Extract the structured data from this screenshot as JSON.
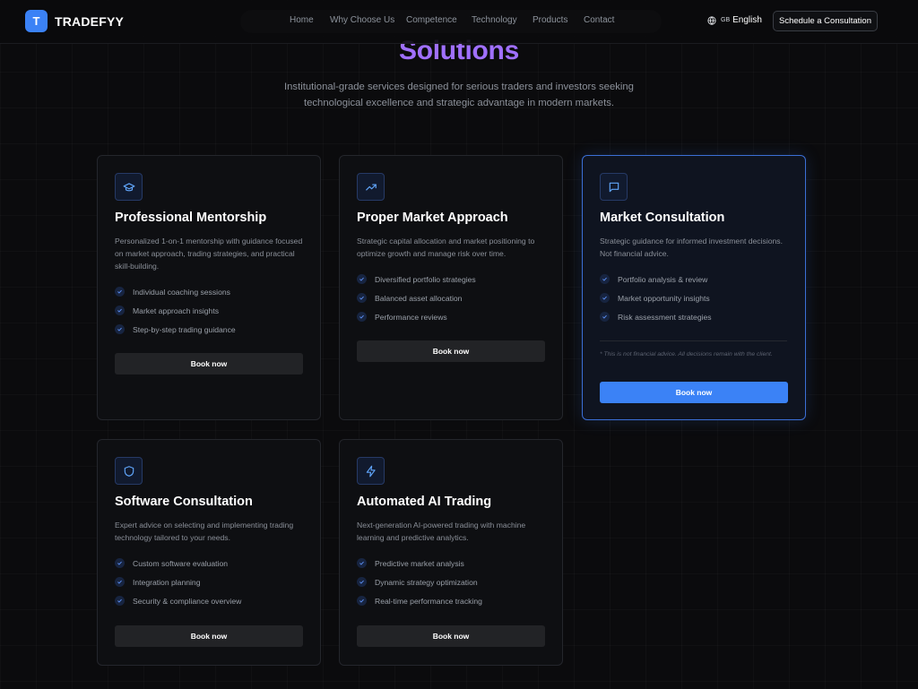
{
  "brand": {
    "logo_letter": "T",
    "name": "TRADEFYY",
    "accent": "#3b82f6"
  },
  "nav": {
    "links": [
      "Home",
      "Why Choose Us",
      "Competence",
      "Technology",
      "Products",
      "Contact"
    ],
    "language_flag": "GB",
    "language": "English",
    "cta": "Schedule a Consultation"
  },
  "hero": {
    "title": "Solutions",
    "subtitle": "Institutional-grade services designed for serious traders and investors seeking technological excellence and strategic advantage in modern markets.",
    "title_color": "#a070ff"
  },
  "cards": [
    {
      "icon": "graduation-cap-icon",
      "title": "Professional Mentorship",
      "description": "Personalized 1-on-1 mentorship with guidance focused on market approach, trading strategies, and practical skill-building.",
      "features": [
        "Individual coaching sessions",
        "Market approach insights",
        "Step-by-step trading guidance"
      ],
      "button": "Book now"
    },
    {
      "icon": "trending-up-icon",
      "title": "Proper Market Approach",
      "description": "Strategic capital allocation and market positioning to optimize growth and manage risk over time.",
      "features": [
        "Diversified portfolio strategies",
        "Balanced asset allocation",
        "Performance reviews"
      ],
      "button": "Book now"
    },
    {
      "icon": "message-square-icon",
      "title": "Market Consultation",
      "description": "Strategic guidance for informed investment decisions. Not financial advice.",
      "features": [
        "Portfolio analysis & review",
        "Market opportunity insights",
        "Risk assessment strategies"
      ],
      "disclaimer": "* This is not financial advice. All decisions remain with the client.",
      "button": "Book now",
      "featured": true
    },
    {
      "icon": "shield-icon",
      "title": "Software Consultation",
      "description": "Expert advice on selecting and implementing trading technology tailored to your needs.",
      "features": [
        "Custom software evaluation",
        "Integration planning",
        "Security & compliance overview"
      ],
      "button": "Book now"
    },
    {
      "icon": "lightning-icon",
      "title": "Automated AI Trading",
      "description": "Next-generation AI-powered trading with machine learning and predictive analytics.",
      "features": [
        "Predictive market analysis",
        "Dynamic strategy optimization",
        "Real-time performance tracking"
      ],
      "button": "Book now"
    }
  ]
}
